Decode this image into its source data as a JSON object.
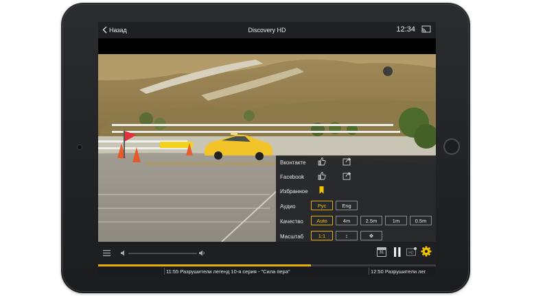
{
  "topbar": {
    "back_label": "Назад",
    "channel_title": "Discovery HD",
    "clock": "12:34",
    "icons": {
      "back": "chevron-left-icon",
      "cast": "cast-icon"
    }
  },
  "share_menu": {
    "vk_label": "Вконтакте",
    "facebook_label": "Facebook",
    "favorites_label": "Избранное",
    "audio_label": "Аудио",
    "audio_options": [
      "Рус",
      "Eng"
    ],
    "audio_selected": "Рус",
    "quality_label": "Качество",
    "quality_options": [
      "Auto",
      "4m",
      "2.5m",
      "1m",
      "0.5m"
    ],
    "quality_selected": "Auto",
    "scale_label": "Масштаб",
    "scale_options": [
      "1:1",
      "↕",
      "✥"
    ],
    "scale_selected": "1:1",
    "icons": {
      "like": "thumbs-up-icon",
      "share": "share-icon",
      "favorite": "bookmark-icon",
      "vertical": "vertical-arrows-icon",
      "move": "move-arrows-icon"
    }
  },
  "controls": {
    "volume_level": 0.0,
    "epg_button_label": "31",
    "icons": {
      "playlist": "list-icon",
      "volume_low": "volume-low-icon",
      "volume_high": "volume-high-icon",
      "calendar": "calendar-icon",
      "pause": "pause-icon",
      "hd": "hd-icon",
      "settings": "gear-icon"
    }
  },
  "playback": {
    "progress": 0.63
  },
  "epg": {
    "current": "11:55 Разрушители легенд 10-я серия - \"Сила пера\"",
    "next": "12:50 Разрушители лег"
  },
  "colors": {
    "accent": "#e8b100",
    "panel": "#1f2125",
    "topbar": "#1e2024"
  }
}
